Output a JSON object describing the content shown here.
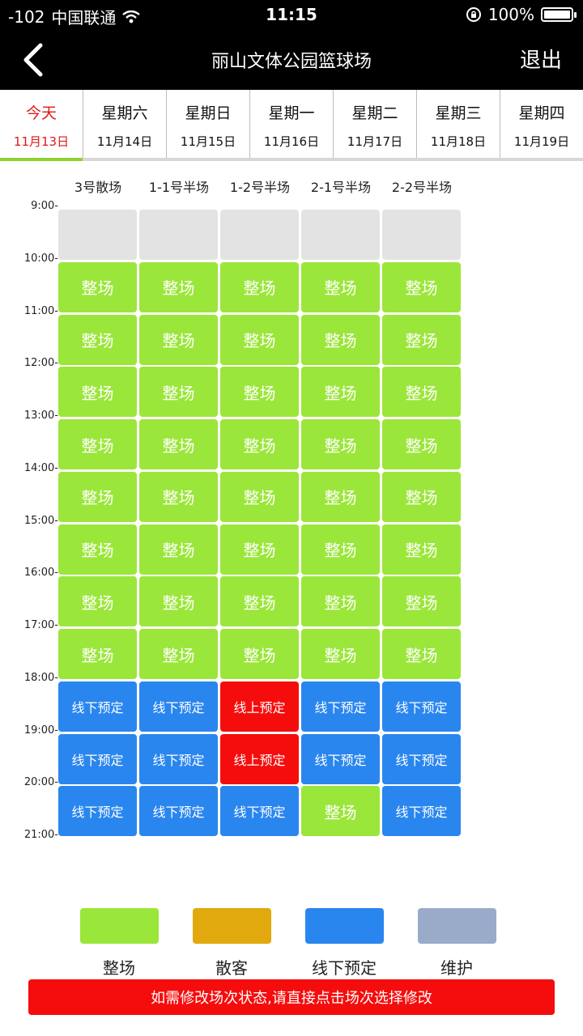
{
  "status_bar": {
    "signal": "-102",
    "carrier": "中国联通",
    "time": "11:15",
    "battery": "100%"
  },
  "nav": {
    "title": "丽山文体公园篮球场",
    "logout_label": "退出"
  },
  "tabs": [
    {
      "day": "今天",
      "date": "11月13日",
      "active": true
    },
    {
      "day": "星期六",
      "date": "11月14日"
    },
    {
      "day": "星期日",
      "date": "11月15日"
    },
    {
      "day": "星期一",
      "date": "11月16日"
    },
    {
      "day": "星期二",
      "date": "11月17日"
    },
    {
      "day": "星期三",
      "date": "11月18日"
    },
    {
      "day": "星期四",
      "date": "11月19日"
    }
  ],
  "courts": [
    "3号散场",
    "1-1号半场",
    "1-2号半场",
    "2-1号半场",
    "2-2号半场"
  ],
  "times": [
    "9:00-",
    "10:00-",
    "11:00-",
    "12:00-",
    "13:00-",
    "14:00-",
    "15:00-",
    "16:00-",
    "17:00-",
    "18:00-",
    "19:00-",
    "20:00-",
    "21:00-"
  ],
  "cell_types": {
    "empty": "",
    "whole": "整场",
    "offline": "线下预定",
    "online": "线上预定"
  },
  "schedule": [
    [
      "empty",
      "empty",
      "empty",
      "empty",
      "empty"
    ],
    [
      "whole",
      "whole",
      "whole",
      "whole",
      "whole"
    ],
    [
      "whole",
      "whole",
      "whole",
      "whole",
      "whole"
    ],
    [
      "whole",
      "whole",
      "whole",
      "whole",
      "whole"
    ],
    [
      "whole",
      "whole",
      "whole",
      "whole",
      "whole"
    ],
    [
      "whole",
      "whole",
      "whole",
      "whole",
      "whole"
    ],
    [
      "whole",
      "whole",
      "whole",
      "whole",
      "whole"
    ],
    [
      "whole",
      "whole",
      "whole",
      "whole",
      "whole"
    ],
    [
      "whole",
      "whole",
      "whole",
      "whole",
      "whole"
    ],
    [
      "offline",
      "offline",
      "online",
      "offline",
      "offline"
    ],
    [
      "offline",
      "offline",
      "online",
      "offline",
      "offline"
    ],
    [
      "offline",
      "offline",
      "offline",
      "whole",
      "offline"
    ]
  ],
  "legend": [
    {
      "label": "整场",
      "color": "#9be63a"
    },
    {
      "label": "散客",
      "color": "#e1a90e"
    },
    {
      "label": "线下预定",
      "color": "#2a86ef"
    },
    {
      "label": "维护",
      "color": "#9aabc9"
    }
  ],
  "notice": "如需修改场次状态,请直接点击场次选择修改"
}
